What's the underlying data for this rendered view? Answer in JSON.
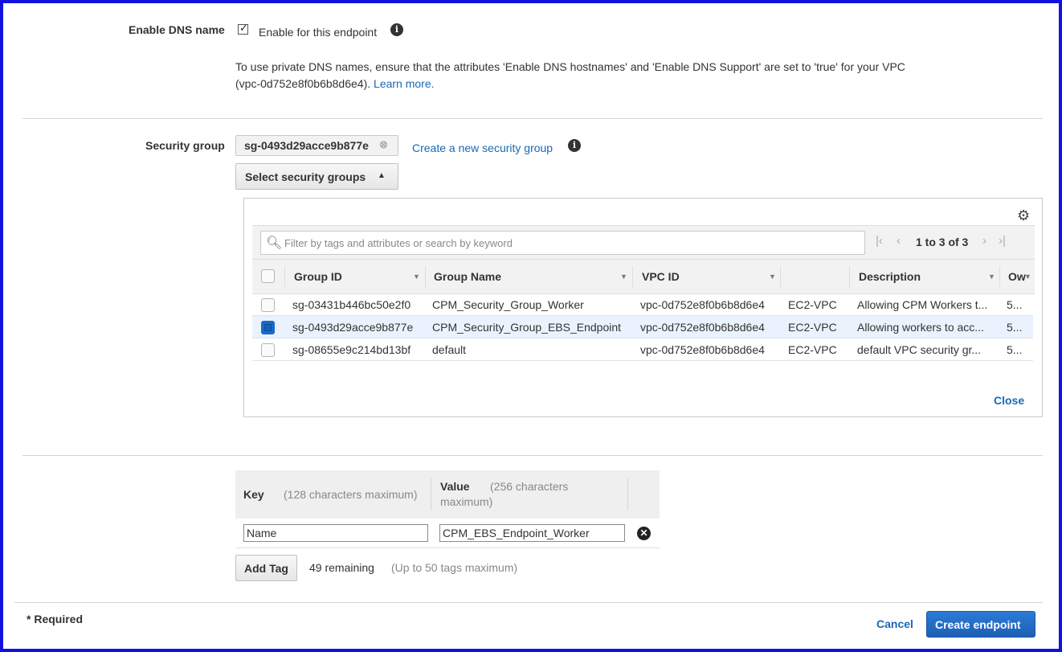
{
  "dns": {
    "label": "Enable DNS name",
    "checkbox_label": "Enable for this endpoint",
    "info_icon": "info-icon",
    "help_text_line1": "To use private DNS names, ensure that the attributes 'Enable DNS hostnames' and 'Enable DNS Support' are set to 'true' for your VPC",
    "help_text_line2": "(vpc-0d752e8f0b6b8d6e4).",
    "learn_more": "Learn more",
    "learn_more_period": "."
  },
  "security_group": {
    "label": "Security group",
    "selected_token": "sg-0493d29acce9b877e",
    "create_link": "Create a new security group",
    "select_button": "Select security groups",
    "panel": {
      "search_placeholder": "Filter by tags and attributes or search by keyword",
      "pagination": "1 to 3 of 3",
      "close": "Close",
      "columns": [
        "Group ID",
        "Group Name",
        "VPC ID",
        "",
        "Description",
        "Ow"
      ],
      "rows": [
        {
          "group_id": "sg-03431b446bc50e2f0",
          "group_name": "CPM_Security_Group_Worker",
          "vpc_id": "vpc-0d752e8f0b6b8d6e4",
          "platform": "EC2-VPC",
          "description": "Allowing CPM Workers t...",
          "owner": "5...",
          "selected": false
        },
        {
          "group_id": "sg-0493d29acce9b877e",
          "group_name": "CPM_Security_Group_EBS_Endpoint",
          "vpc_id": "vpc-0d752e8f0b6b8d6e4",
          "platform": "EC2-VPC",
          "description": "Allowing workers to acc...",
          "owner": "5...",
          "selected": true
        },
        {
          "group_id": "sg-08655e9c214bd13bf",
          "group_name": "default",
          "vpc_id": "vpc-0d752e8f0b6b8d6e4",
          "platform": "EC2-VPC",
          "description": "default VPC security gr...",
          "owner": "5...",
          "selected": false
        }
      ]
    }
  },
  "tags": {
    "key_header": "Key",
    "key_hint": "(128 characters maximum)",
    "value_header": "Value",
    "value_hint_line1": "(256 characters",
    "value_hint_line2": "maximum)",
    "key_value": "Name",
    "value_value": "CPM_EBS_Endpoint_Worker",
    "add_tag": "Add Tag",
    "remaining": "49 remaining",
    "max_hint": "(Up to 50 tags maximum)"
  },
  "footer": {
    "required": "* Required",
    "cancel": "Cancel",
    "create": "Create endpoint"
  },
  "colors": {
    "border_frame": "#1212e0",
    "link": "#1769b7",
    "primary": "#1c66c4",
    "selected_row": "#eaf3fd"
  }
}
